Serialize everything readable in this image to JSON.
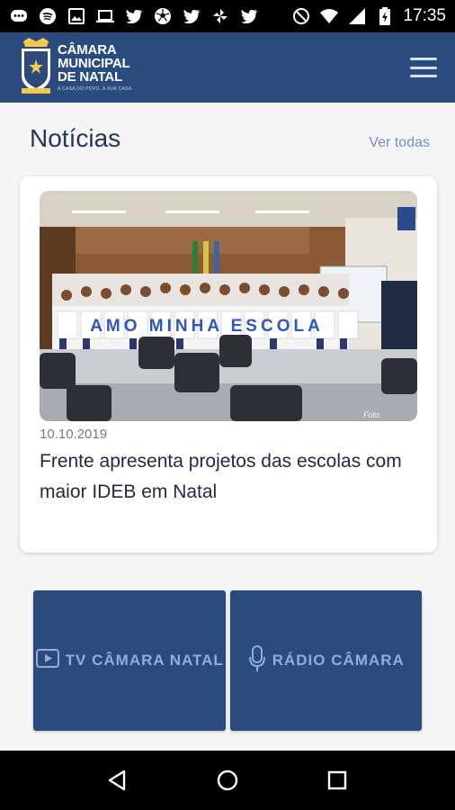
{
  "status_bar": {
    "time": "17:35",
    "left_icons": [
      "message-icon",
      "spotify-icon",
      "image-icon",
      "laptop-icon",
      "twitter-icon",
      "soccer-ball-icon",
      "twitter-icon",
      "pinwheel-icon",
      "twitter-icon"
    ],
    "right_icons": [
      "do-not-disturb-icon",
      "wifi-icon",
      "signal-icon",
      "battery-charging-icon"
    ]
  },
  "header": {
    "logo_lines": [
      "CÂMARA",
      "MUNICIPAL",
      "DE NATAL"
    ],
    "logo_tagline": "A CASA DO POVO. A SUA CASA.",
    "menu_icon": "hamburger-menu-icon",
    "bg_color": "#2b4a7e"
  },
  "news": {
    "section_title": "Notícias",
    "see_all_label": "Ver todas",
    "items": [
      {
        "date": "10.10.2019",
        "headline": "Frente apresenta projetos das escolas com maior IDEB em Natal",
        "image_caption_sign": "AMO MINHA ESCOLA"
      }
    ]
  },
  "tiles": [
    {
      "icon": "play-video-icon",
      "label": "TV CÂMARA NATAL"
    },
    {
      "icon": "microphone-icon",
      "label": "RÁDIO CÂMARA"
    }
  ],
  "nav_bar": {
    "buttons": [
      "back-triangle-icon",
      "home-circle-icon",
      "recents-square-icon"
    ]
  }
}
